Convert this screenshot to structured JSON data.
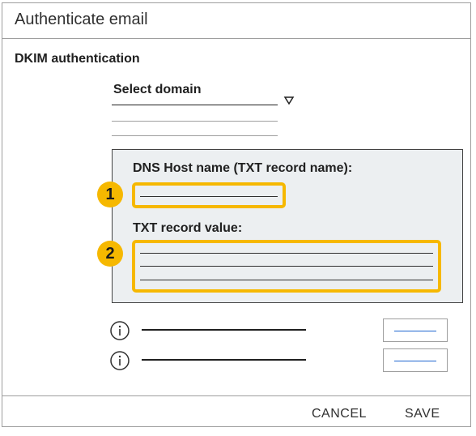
{
  "dialog": {
    "title": "Authenticate email",
    "section_title": "DKIM authentication"
  },
  "domain_select": {
    "label": "Select domain",
    "arrow_icon": "triangle-down-icon"
  },
  "dns_panel": {
    "host_label": "DNS Host name (TXT record name):",
    "value_label": "TXT record value:",
    "callouts": [
      "1",
      "2"
    ],
    "highlight_color": "#f6b800",
    "panel_background": "#eceff1"
  },
  "rows": [
    {
      "icon": "info-icon"
    },
    {
      "icon": "info-icon"
    }
  ],
  "footer": {
    "cancel_label": "CANCEL",
    "save_label": "SAVE"
  },
  "colors": {
    "accent_blue": "#1e66d0",
    "highlight": "#f6b800"
  }
}
